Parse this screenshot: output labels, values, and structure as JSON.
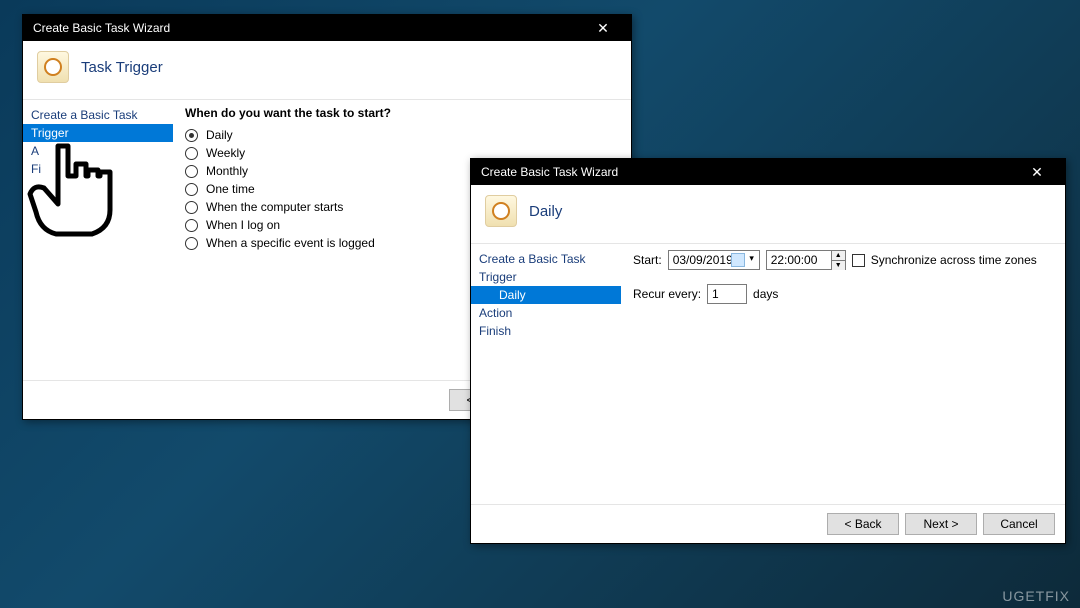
{
  "window1": {
    "title": "Create Basic Task Wizard",
    "header": "Task Trigger",
    "sidebar": {
      "item0": "Create a Basic Task",
      "item1": "Trigger",
      "item2": "A",
      "item3": "Fi"
    },
    "question": "When do you want the task to start?",
    "opts": {
      "o0": "Daily",
      "o1": "Weekly",
      "o2": "Monthly",
      "o3": "One time",
      "o4": "When the computer starts",
      "o5": "When I log on",
      "o6": "When a specific event is logged"
    },
    "buttons": {
      "back": "<  Back"
    }
  },
  "window2": {
    "title": "Create Basic Task Wizard",
    "header": "Daily",
    "sidebar": {
      "item0": "Create a Basic Task",
      "item1": "Trigger",
      "item2": "Daily",
      "item3": "Action",
      "item4": "Finish"
    },
    "start_label": "Start:",
    "date": "03/09/2019",
    "time": "22:00:00",
    "tz_label": "Synchronize across time zones",
    "recur_label": "Recur every:",
    "recur_val": "1",
    "recur_unit": "days",
    "buttons": {
      "back": "<  Back",
      "next": "Next  >",
      "cancel": "Cancel"
    }
  },
  "watermark": "UGETFIX"
}
